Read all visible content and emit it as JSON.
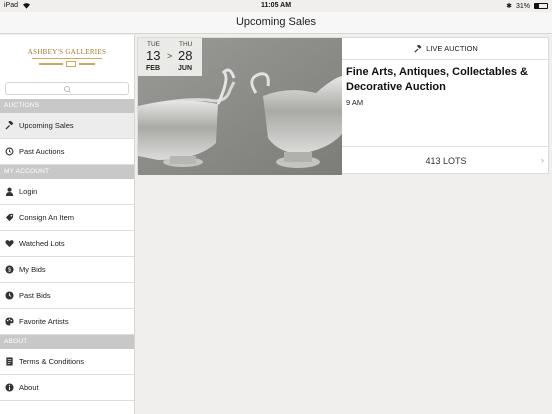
{
  "status_bar": {
    "device": "iPad",
    "time": "11:05 AM",
    "battery": "31%"
  },
  "nav": {
    "title": "Upcoming Sales"
  },
  "sidebar": {
    "logo_text": "ASHBEY'S GALLERIES",
    "sections": {
      "auctions": "AUCTIONS",
      "my_account": "MY ACCOUNT",
      "about": "ABOUT"
    },
    "items": {
      "upcoming_sales": "Upcoming Sales",
      "past_auctions": "Past Auctions",
      "login": "Login",
      "consign": "Consign An Item",
      "watched": "Watched Lots",
      "my_bids": "My Bids",
      "past_bids": "Past Bids",
      "favorite_artists": "Favorite Artists",
      "terms": "Terms & Conditions",
      "about": "About"
    }
  },
  "auction": {
    "start": {
      "dow": "TUE",
      "day": "13",
      "month": "FEB"
    },
    "end": {
      "dow": "THU",
      "day": "28",
      "month": "JUN"
    },
    "live_label": "LIVE AUCTION",
    "title": "Fine Arts, Antiques, Collectables & Decorative Auction",
    "time": "9 AM",
    "lots": "413 LOTS"
  },
  "colors": {
    "section_header": "#c8c8c8",
    "logo_gold": "#a0792d",
    "page_bg": "#f0efed"
  }
}
